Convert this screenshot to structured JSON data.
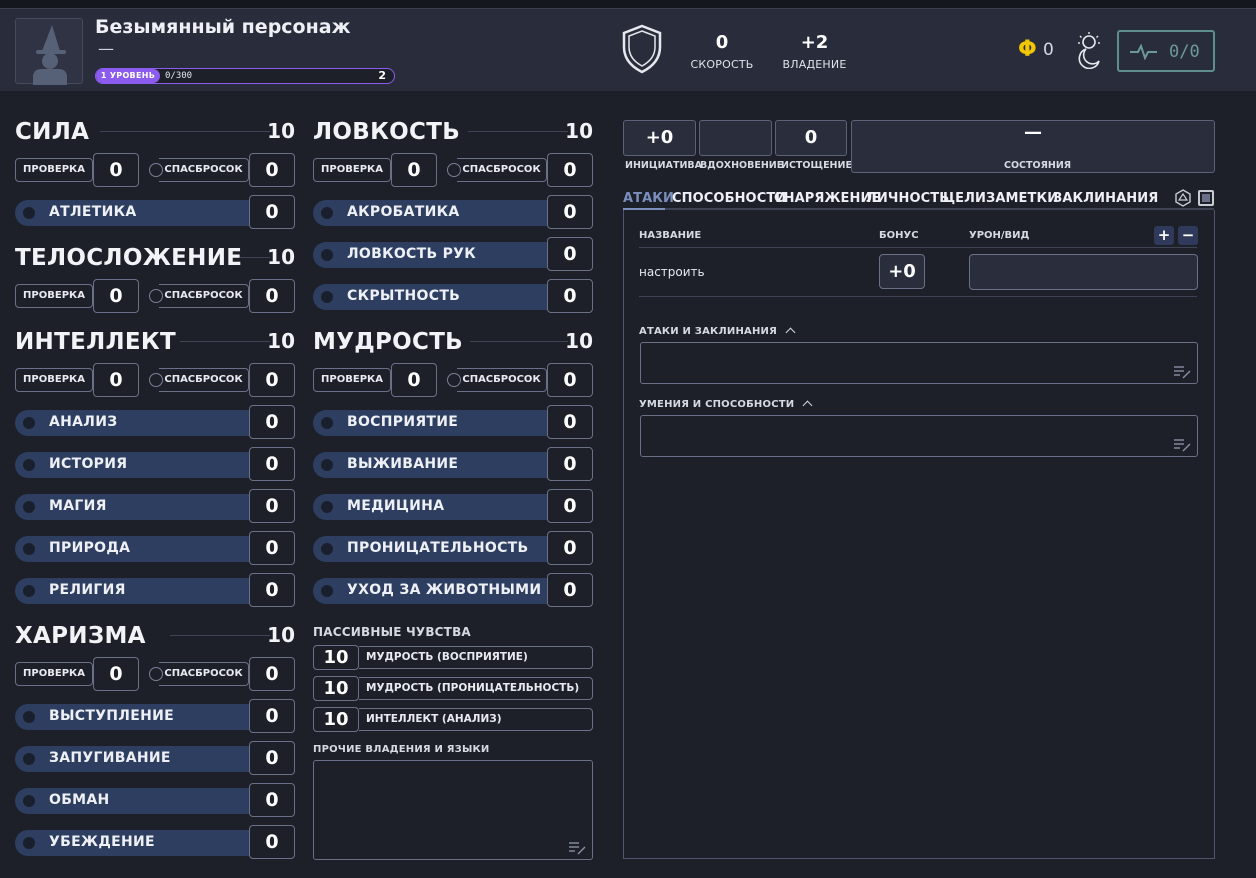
{
  "header": {
    "character_name": "Безымянный персонаж",
    "character_subtitle": "—",
    "level_label": "1 УРОВЕНЬ",
    "xp_text": "0/300",
    "next_level": "2",
    "speed_value": "0",
    "speed_label": "СКОРОСТЬ",
    "proficiency_value": "+2",
    "proficiency_label": "ВЛАДЕНИЕ",
    "coins": "0",
    "hp_text": "0/0",
    "icons": {
      "avatar": "wizard-placeholder-icon",
      "armor": "shield-icon",
      "coin": "coin-icon",
      "rest": "rest-icon",
      "hp": "heartbeat-icon"
    },
    "colors": {
      "level_accent": "#8c5cf0",
      "coin": "#f2c700",
      "hp": "#6c9a98"
    }
  },
  "common": {
    "check_label": "ПРОВЕРКА",
    "save_label": "СПАСБРОСОК"
  },
  "abilities": {
    "str": {
      "name": "СИЛА",
      "score": "10",
      "check": "0",
      "save": "0",
      "skills": [
        {
          "name": "АТЛЕТИКА",
          "value": "0"
        }
      ]
    },
    "con": {
      "name": "ТЕЛОСЛОЖЕНИЕ",
      "score": "10",
      "check": "0",
      "save": "0"
    },
    "int": {
      "name": "ИНТЕЛЛЕКТ",
      "score": "10",
      "check": "0",
      "save": "0",
      "skills": [
        {
          "name": "АНАЛИЗ",
          "value": "0"
        },
        {
          "name": "ИСТОРИЯ",
          "value": "0"
        },
        {
          "name": "МАГИЯ",
          "value": "0"
        },
        {
          "name": "ПРИРОДА",
          "value": "0"
        },
        {
          "name": "РЕЛИГИЯ",
          "value": "0"
        }
      ]
    },
    "cha": {
      "name": "ХАРИЗМА",
      "score": "10",
      "check": "0",
      "save": "0",
      "skills": [
        {
          "name": "ВЫСТУПЛЕНИЕ",
          "value": "0"
        },
        {
          "name": "ЗАПУГИВАНИЕ",
          "value": "0"
        },
        {
          "name": "ОБМАН",
          "value": "0"
        },
        {
          "name": "УБЕЖДЕНИЕ",
          "value": "0"
        }
      ]
    },
    "dex": {
      "name": "ЛОВКОСТЬ",
      "score": "10",
      "check": "0",
      "save": "0",
      "skills": [
        {
          "name": "АКРОБАТИКА",
          "value": "0"
        },
        {
          "name": "ЛОВКОСТЬ РУК",
          "value": "0"
        },
        {
          "name": "СКРЫТНОСТЬ",
          "value": "0"
        }
      ]
    },
    "wis": {
      "name": "МУДРОСТЬ",
      "score": "10",
      "check": "0",
      "save": "0",
      "skills": [
        {
          "name": "ВОСПРИЯТИЕ",
          "value": "0"
        },
        {
          "name": "ВЫЖИВАНИЕ",
          "value": "0"
        },
        {
          "name": "МЕДИЦИНА",
          "value": "0"
        },
        {
          "name": "ПРОНИЦАТЕЛЬНОСТЬ",
          "value": "0"
        },
        {
          "name": "УХОД ЗА ЖИВОТНЫМИ",
          "value": "0"
        }
      ]
    }
  },
  "passive": {
    "title": "ПАССИВНЫЕ ЧУВСТВА",
    "items": [
      {
        "value": "10",
        "label": "МУДРОСТЬ (ВОСПРИЯТИЕ)"
      },
      {
        "value": "10",
        "label": "МУДРОСТЬ (ПРОНИЦАТЕЛЬНОСТЬ)"
      },
      {
        "value": "10",
        "label": "ИНТЕЛЛЕКТ (АНАЛИЗ)"
      }
    ]
  },
  "other_proficiencies": {
    "title": "ПРОЧИЕ ВЛАДЕНИЯ И ЯЗЫКИ"
  },
  "combat": {
    "initiative_value": "+0",
    "initiative_label": "ИНИЦИАТИВА",
    "inspiration_value": "",
    "inspiration_label": "ВДОХНОВЕНИЕ",
    "exhaustion_value": "0",
    "exhaustion_label": "ИСТОЩЕНИЕ",
    "conditions_value": "—",
    "conditions_label": "СОСТОЯНИЯ"
  },
  "tabs": [
    "АТАКИ",
    "СПОСОБНОСТИ",
    "СНАРЯЖЕНИЕ",
    "ЛИЧНОСТЬ",
    "ЦЕЛИ",
    "ЗАМЕТКИ",
    "ЗАКЛИНАНИЯ"
  ],
  "attacks": {
    "col_name": "НАЗВАНИЕ",
    "col_bonus": "БОНУС",
    "col_damage": "УРОН/ВИД",
    "add_label": "+",
    "remove_label": "−",
    "rows": [
      {
        "name": "настроить",
        "bonus": "+0",
        "damage": ""
      }
    ],
    "attacks_spells_title": "АТАКИ И ЗАКЛИНАНИЯ",
    "features_title": "УМЕНИЯ И СПОСОБНОСТИ"
  }
}
